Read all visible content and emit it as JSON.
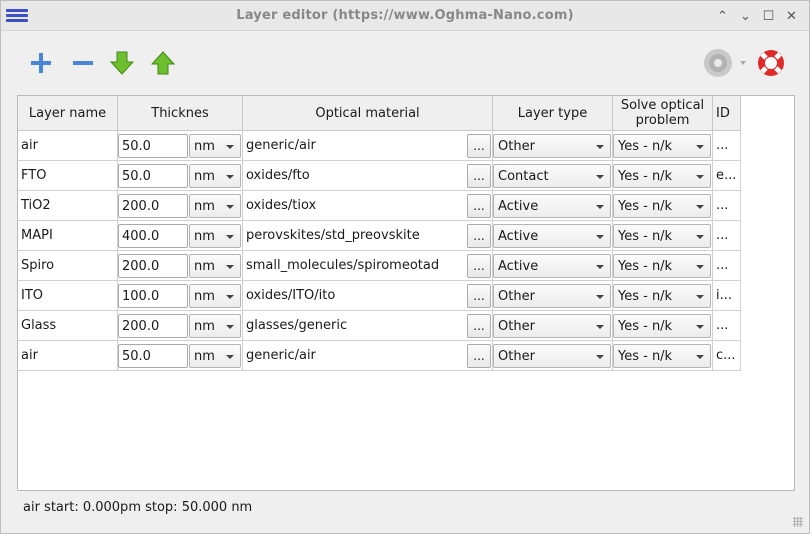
{
  "window": {
    "title": "Layer editor (https://www.Oghma-Nano.com)",
    "controls": [
      "⌃",
      "⌄",
      "☐",
      "✕"
    ]
  },
  "toolbar": {
    "add_icon": "plus-icon",
    "remove_icon": "minus-icon",
    "move_down_icon": "arrow-down-icon",
    "move_up_icon": "arrow-up-icon",
    "disc_icon": "disc-icon",
    "help_icon": "lifebuoy-icon"
  },
  "table": {
    "headers": [
      "Layer name",
      "Thicknes",
      "Optical material",
      "Layer type",
      "Solve optical problem",
      "ID"
    ],
    "rows": [
      {
        "name": "air",
        "thickness": "50.0",
        "unit": "nm",
        "material": "generic/air",
        "type": "Other",
        "solve": "Yes - n/k",
        "id": "..."
      },
      {
        "name": "FTO",
        "thickness": "50.0",
        "unit": "nm",
        "material": "oxides/fto",
        "type": "Contact",
        "solve": "Yes - n/k",
        "id": "e..."
      },
      {
        "name": "TiO2",
        "thickness": "200.0",
        "unit": "nm",
        "material": "oxides/tiox",
        "type": "Active",
        "solve": "Yes - n/k",
        "id": "..."
      },
      {
        "name": "MAPI",
        "thickness": "400.0",
        "unit": "nm",
        "material": "perovskites/std_preovskite",
        "type": "Active",
        "solve": "Yes - n/k",
        "id": "..."
      },
      {
        "name": "Spiro",
        "thickness": "200.0",
        "unit": "nm",
        "material": "small_molecules/spiromeotad",
        "type": "Active",
        "solve": "Yes - n/k",
        "id": "..."
      },
      {
        "name": "ITO",
        "thickness": "100.0",
        "unit": "nm",
        "material": "oxides/ITO/ito",
        "type": "Other",
        "solve": "Yes - n/k",
        "id": "i..."
      },
      {
        "name": "Glass",
        "thickness": "200.0",
        "unit": "nm",
        "material": "glasses/generic",
        "type": "Other",
        "solve": "Yes - n/k",
        "id": "..."
      },
      {
        "name": "air",
        "thickness": "50.0",
        "unit": "nm",
        "material": "generic/air",
        "type": "Other",
        "solve": "Yes - n/k",
        "id": "c..."
      }
    ],
    "browse_label": "..."
  },
  "status": {
    "text": "air start: 0.000pm stop: 50.000 nm"
  }
}
